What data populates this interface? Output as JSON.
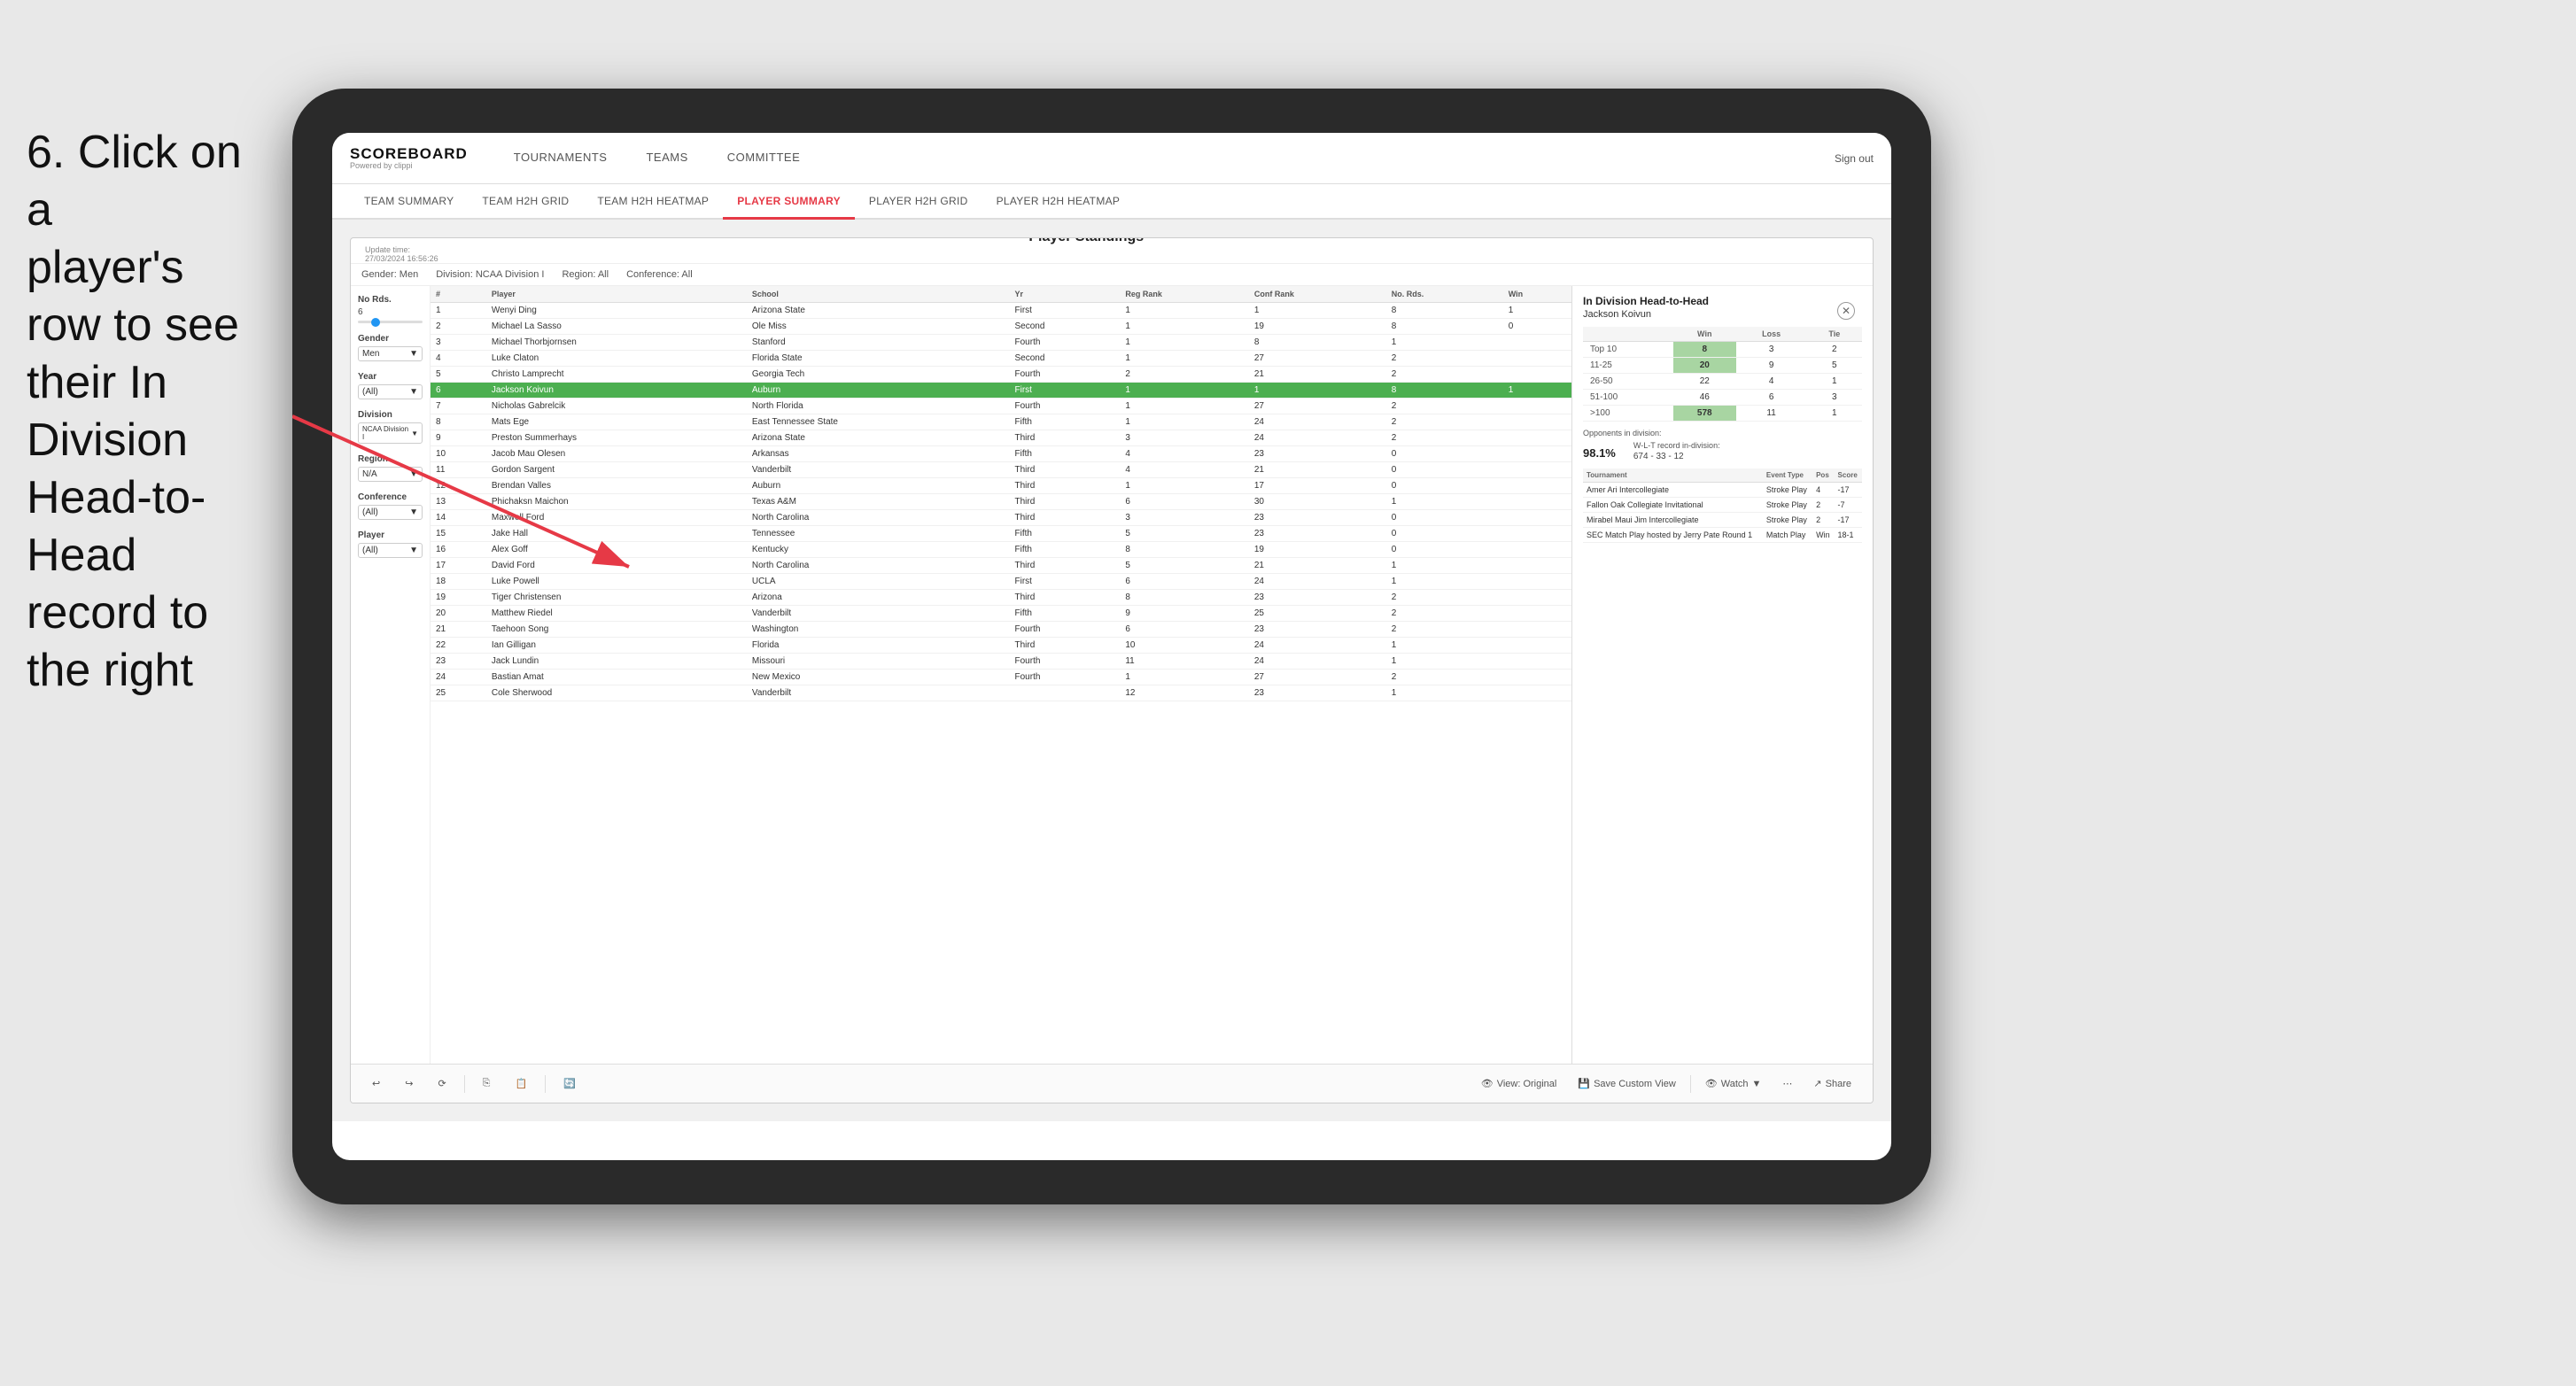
{
  "instruction": {
    "line1": "6. Click on a",
    "line2": "player's row to see",
    "line3": "their In Division",
    "line4": "Head-to-Head",
    "line5": "record to the right"
  },
  "nav": {
    "logo_title": "SCOREBOARD",
    "logo_sub": "Powered by clippi",
    "items": [
      "TOURNAMENTS",
      "TEAMS",
      "COMMITTEE"
    ],
    "sign_out": "Sign out"
  },
  "sub_nav": {
    "items": [
      "TEAM SUMMARY",
      "TEAM H2H GRID",
      "TEAM H2H HEATMAP",
      "PLAYER SUMMARY",
      "PLAYER H2H GRID",
      "PLAYER H2H HEATMAP"
    ],
    "active": "PLAYER SUMMARY"
  },
  "dashboard": {
    "update_time_label": "Update time:",
    "update_time": "27/03/2024 16:56:26",
    "title": "Player Standings",
    "filters": {
      "no_rds_label": "No Rds.",
      "no_rds_value": "6",
      "gender_label": "Gender",
      "gender_value": "Men",
      "year_label": "Year",
      "year_value": "(All)",
      "division_label": "Division",
      "division_value": "NCAA Division I",
      "region_label": "Region",
      "region_value": "N/A",
      "conference_label": "Conference",
      "conference_value": "(All)",
      "player_label": "Player",
      "player_value": "(All)"
    },
    "filter_bar": {
      "gender": "Gender: Men",
      "division": "Division: NCAA Division I",
      "region": "Region: All",
      "conference": "Conference: All"
    },
    "table": {
      "headers": [
        "#",
        "Player",
        "School",
        "Yr",
        "Reg Rank",
        "Conf Rank",
        "No. Rds.",
        "Win"
      ],
      "rows": [
        {
          "num": "1",
          "player": "Wenyi Ding",
          "school": "Arizona State",
          "yr": "First",
          "reg": "1",
          "conf": "1",
          "rds": "8",
          "win": "1"
        },
        {
          "num": "2",
          "player": "Michael La Sasso",
          "school": "Ole Miss",
          "yr": "Second",
          "reg": "1",
          "conf": "19",
          "rds": "8",
          "win": "0"
        },
        {
          "num": "3",
          "player": "Michael Thorbjornsen",
          "school": "Stanford",
          "yr": "Fourth",
          "reg": "1",
          "conf": "8",
          "rds": "1",
          "win": ""
        },
        {
          "num": "4",
          "player": "Luke Claton",
          "school": "Florida State",
          "yr": "Second",
          "reg": "1",
          "conf": "27",
          "rds": "2",
          "win": ""
        },
        {
          "num": "5",
          "player": "Christo Lamprecht",
          "school": "Georgia Tech",
          "yr": "Fourth",
          "reg": "2",
          "conf": "21",
          "rds": "2",
          "win": ""
        },
        {
          "num": "6",
          "player": "Jackson Koivun",
          "school": "Auburn",
          "yr": "First",
          "reg": "1",
          "conf": "1",
          "rds": "8",
          "win": "1",
          "selected": true
        },
        {
          "num": "7",
          "player": "Nicholas Gabrelcik",
          "school": "North Florida",
          "yr": "Fourth",
          "reg": "1",
          "conf": "27",
          "rds": "2",
          "win": ""
        },
        {
          "num": "8",
          "player": "Mats Ege",
          "school": "East Tennessee State",
          "yr": "Fifth",
          "reg": "1",
          "conf": "24",
          "rds": "2",
          "win": ""
        },
        {
          "num": "9",
          "player": "Preston Summerhays",
          "school": "Arizona State",
          "yr": "Third",
          "reg": "3",
          "conf": "24",
          "rds": "2",
          "win": ""
        },
        {
          "num": "10",
          "player": "Jacob Mau Olesen",
          "school": "Arkansas",
          "yr": "Fifth",
          "reg": "4",
          "conf": "23",
          "rds": "0",
          "win": ""
        },
        {
          "num": "11",
          "player": "Gordon Sargent",
          "school": "Vanderbilt",
          "yr": "Third",
          "reg": "4",
          "conf": "21",
          "rds": "0",
          "win": ""
        },
        {
          "num": "12",
          "player": "Brendan Valles",
          "school": "Auburn",
          "yr": "Third",
          "reg": "1",
          "conf": "17",
          "rds": "0",
          "win": ""
        },
        {
          "num": "13",
          "player": "Phichaksn Maichon",
          "school": "Texas A&M",
          "yr": "Third",
          "reg": "6",
          "conf": "30",
          "rds": "1",
          "win": ""
        },
        {
          "num": "14",
          "player": "Maxwell Ford",
          "school": "North Carolina",
          "yr": "Third",
          "reg": "3",
          "conf": "23",
          "rds": "0",
          "win": ""
        },
        {
          "num": "15",
          "player": "Jake Hall",
          "school": "Tennessee",
          "yr": "Fifth",
          "reg": "5",
          "conf": "23",
          "rds": "0",
          "win": ""
        },
        {
          "num": "16",
          "player": "Alex Goff",
          "school": "Kentucky",
          "yr": "Fifth",
          "reg": "8",
          "conf": "19",
          "rds": "0",
          "win": ""
        },
        {
          "num": "17",
          "player": "David Ford",
          "school": "North Carolina",
          "yr": "Third",
          "reg": "5",
          "conf": "21",
          "rds": "1",
          "win": ""
        },
        {
          "num": "18",
          "player": "Luke Powell",
          "school": "UCLA",
          "yr": "First",
          "reg": "6",
          "conf": "24",
          "rds": "1",
          "win": ""
        },
        {
          "num": "19",
          "player": "Tiger Christensen",
          "school": "Arizona",
          "yr": "Third",
          "reg": "8",
          "conf": "23",
          "rds": "2",
          "win": ""
        },
        {
          "num": "20",
          "player": "Matthew Riedel",
          "school": "Vanderbilt",
          "yr": "Fifth",
          "reg": "9",
          "conf": "25",
          "rds": "2",
          "win": ""
        },
        {
          "num": "21",
          "player": "Taehoon Song",
          "school": "Washington",
          "yr": "Fourth",
          "reg": "6",
          "conf": "23",
          "rds": "2",
          "win": ""
        },
        {
          "num": "22",
          "player": "Ian Gilligan",
          "school": "Florida",
          "yr": "Third",
          "reg": "10",
          "conf": "24",
          "rds": "1",
          "win": ""
        },
        {
          "num": "23",
          "player": "Jack Lundin",
          "school": "Missouri",
          "yr": "Fourth",
          "reg": "11",
          "conf": "24",
          "rds": "1",
          "win": ""
        },
        {
          "num": "24",
          "player": "Bastian Amat",
          "school": "New Mexico",
          "yr": "Fourth",
          "reg": "1",
          "conf": "27",
          "rds": "2",
          "win": ""
        },
        {
          "num": "25",
          "player": "Cole Sherwood",
          "school": "Vanderbilt",
          "yr": "",
          "reg": "12",
          "conf": "23",
          "rds": "1",
          "win": ""
        }
      ]
    },
    "h2h_panel": {
      "title": "In Division Head-to-Head",
      "player": "Jackson Koivun",
      "table_headers": [
        "",
        "Win",
        "Loss",
        "Tie"
      ],
      "rows": [
        {
          "range": "Top 10",
          "win": "8",
          "loss": "3",
          "tie": "2",
          "highlight": true
        },
        {
          "range": "11-25",
          "win": "20",
          "loss": "9",
          "tie": "5",
          "highlight": true
        },
        {
          "range": "26-50",
          "win": "22",
          "loss": "4",
          "tie": "1",
          "highlight": false
        },
        {
          "range": "51-100",
          "win": "46",
          "loss": "6",
          "tie": "3",
          "highlight": false
        },
        {
          "range": ">100",
          "win": "578",
          "loss": "11",
          "tie": "1",
          "highlight": true
        }
      ],
      "opponents_label": "Opponents in division:",
      "wlt_label": "W-L-T record in-division:",
      "opponents_pct": "98.1%",
      "wlt_record": "674 - 33 - 12",
      "tournament_headers": [
        "Tournament",
        "Event Type",
        "Pos",
        "Score"
      ],
      "tournaments": [
        {
          "name": "Amer Ari Intercollegiate",
          "type": "Stroke Play",
          "pos": "4",
          "score": "-17"
        },
        {
          "name": "Fallon Oak Collegiate Invitational",
          "type": "Stroke Play",
          "pos": "2",
          "score": "-7"
        },
        {
          "name": "Mirabel Maui Jim Intercollegiate",
          "type": "Stroke Play",
          "pos": "2",
          "score": "-17"
        },
        {
          "name": "SEC Match Play hosted by Jerry Pate Round 1",
          "type": "Match Play",
          "pos": "Win",
          "score": "18-1"
        }
      ]
    },
    "toolbar": {
      "view_original": "View: Original",
      "save_custom": "Save Custom View",
      "watch": "Watch",
      "share": "Share"
    }
  }
}
